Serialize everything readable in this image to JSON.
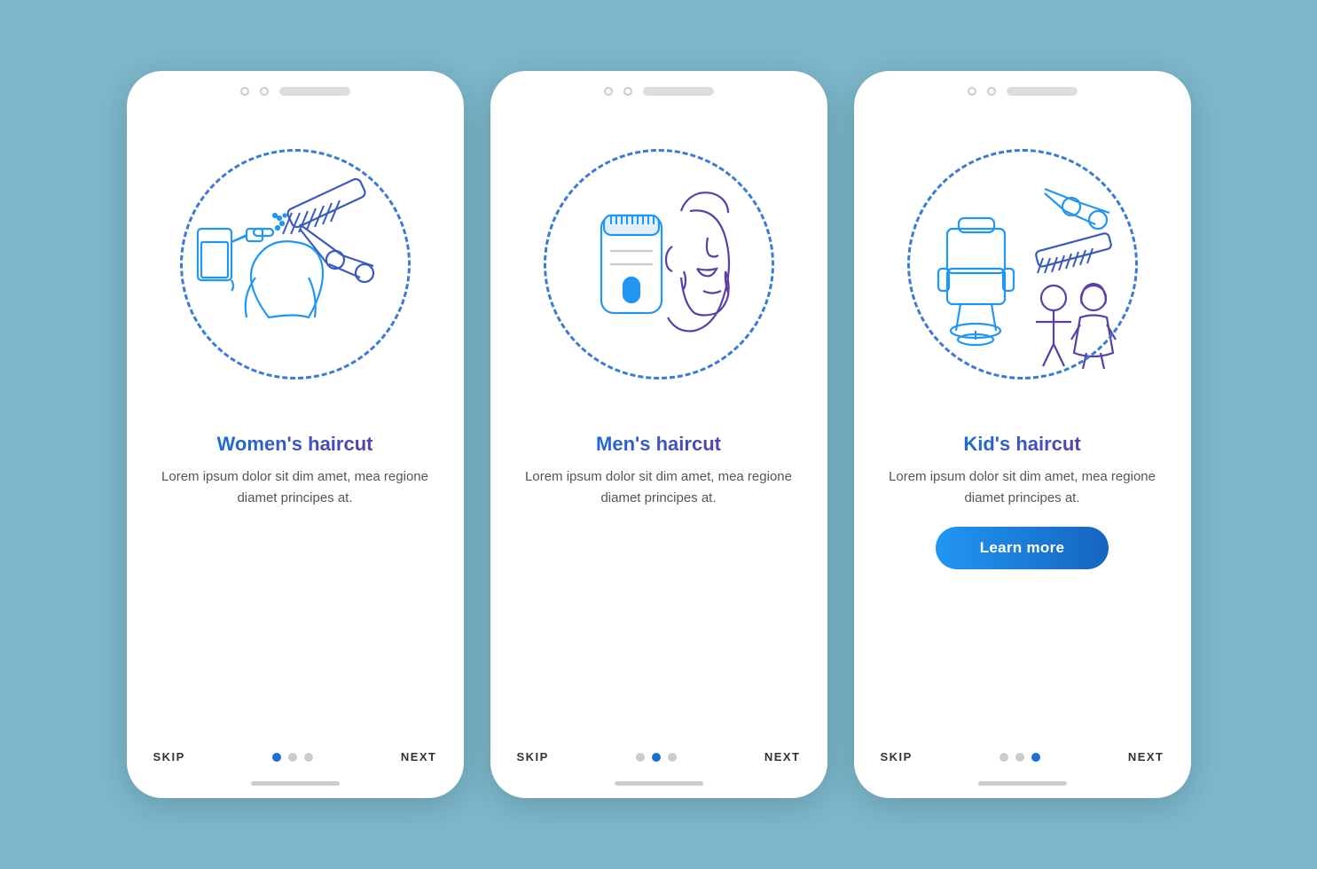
{
  "screens": [
    {
      "id": "womens",
      "title": "Women's haircut",
      "description": "Lorem ipsum dolor sit dim amet, mea regione diamet principes at.",
      "skip_label": "SKIP",
      "next_label": "NEXT",
      "dots": [
        true,
        false,
        false
      ],
      "show_button": false,
      "button_label": ""
    },
    {
      "id": "mens",
      "title": "Men's haircut",
      "description": "Lorem ipsum dolor sit dim amet, mea regione diamet principes at.",
      "skip_label": "SKIP",
      "next_label": "NEXT",
      "dots": [
        false,
        true,
        false
      ],
      "show_button": false,
      "button_label": ""
    },
    {
      "id": "kids",
      "title": "Kid's haircut",
      "description": "Lorem ipsum dolor sit dim amet, mea regione diamet principes at.",
      "skip_label": "SKIP",
      "next_label": "NEXT",
      "dots": [
        false,
        false,
        true
      ],
      "show_button": true,
      "button_label": "Learn more"
    }
  ],
  "colors": {
    "gradient_start": "#1a6fd4",
    "gradient_end": "#5b3fa8",
    "dashed_circle": "#3a7bd5",
    "button_bg": "#2196f3"
  }
}
